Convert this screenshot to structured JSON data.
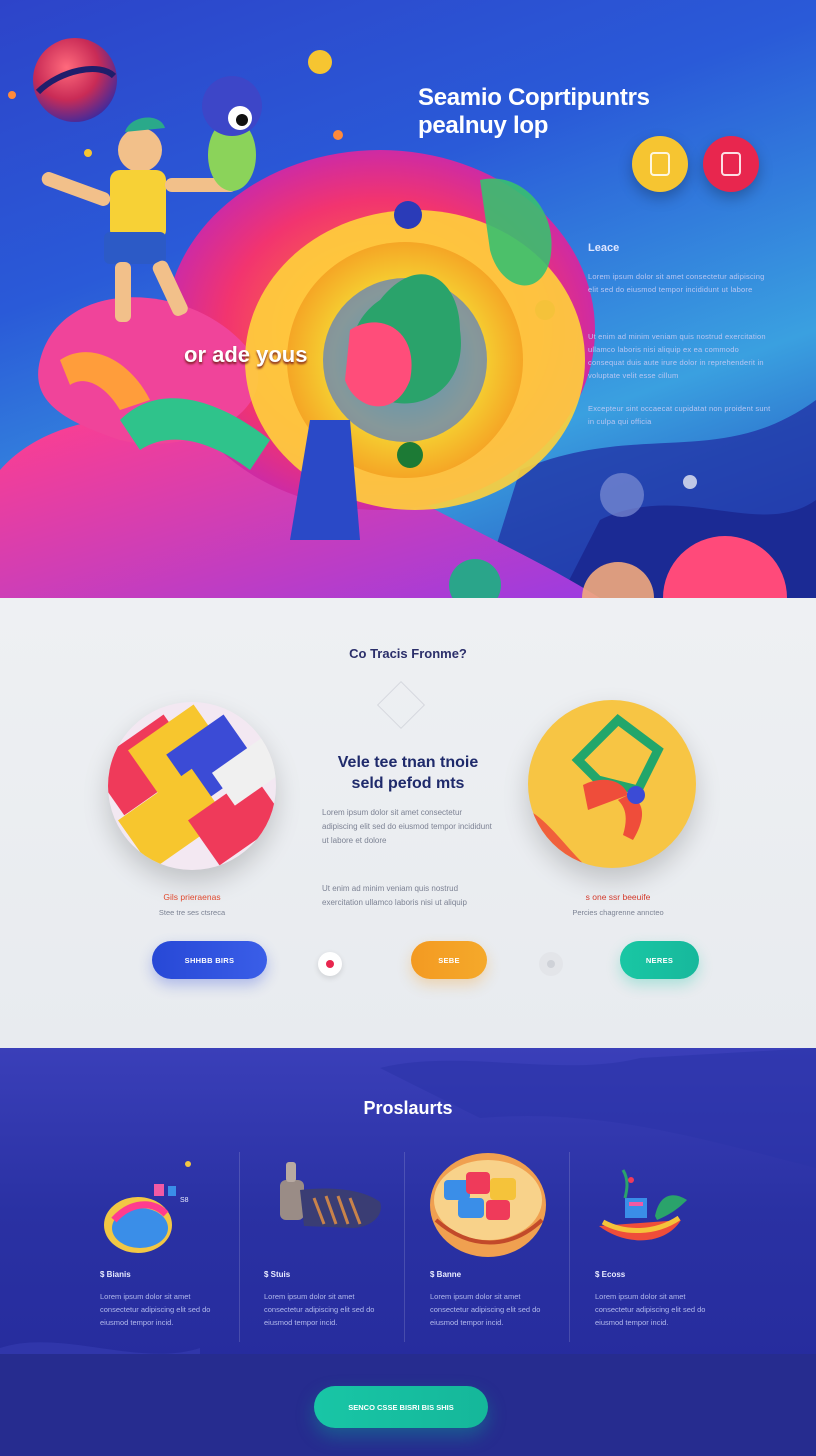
{
  "hero": {
    "title_line1": "Seamio Coprtipuntrs",
    "title_line2": "pealnuy lop",
    "overlay_text": "or ade yous",
    "side_label": "Leace",
    "side_paragraph_1": "Lorem ipsum dolor sit amet consectetur adipiscing elit sed do eiusmod tempor incididunt ut labore",
    "side_paragraph_2": "Ut enim ad minim veniam quis nostrud exercitation ullamco laboris nisi aliquip ex ea commodo consequat duis aute irure dolor in reprehenderit in voluptate velit esse cillum",
    "side_paragraph_3": "Excepteur sint occaecat cupidatat non proident sunt in culpa qui officia",
    "buttons": [
      {
        "color": "#f6c531"
      },
      {
        "color": "#e8264e"
      }
    ]
  },
  "features": {
    "section_title": "Co Tracis Fronme?",
    "center_heading_line1": "Vele tee tnan tnoie",
    "center_heading_line2": "seld pefod mts",
    "center_para_1": "Lorem ipsum dolor sit amet consectetur adipiscing elit sed do eiusmod tempor incididunt ut labore et dolore",
    "center_para_2": "Ut enim ad minim veniam quis nostrud exercitation ullamco laboris nisi ut aliquip",
    "left_caption_title": "Gils prieraenas",
    "left_caption_sub": "Stee tre ses ctsreca",
    "right_caption_title": "s one ssr beeuife",
    "right_caption_sub": "Percies chagrenne anncteo",
    "pill_blue": "SHHBB BIRS",
    "pill_orange": "SEBE",
    "pill_teal": "NERES",
    "colors": {
      "blue": "#2a4ee0",
      "orange": "#f39a22",
      "teal": "#1ec6a2",
      "red": "#e8264e"
    }
  },
  "products": {
    "title": "Proslaurts",
    "items": [
      {
        "name": "$ Bianis",
        "desc": "Lorem ipsum dolor sit amet consectetur adipiscing elit sed do eiusmod tempor incid."
      },
      {
        "name": "$ Stuis",
        "desc": "Lorem ipsum dolor sit amet consectetur adipiscing elit sed do eiusmod tempor incid."
      },
      {
        "name": "$ Banne",
        "desc": "Lorem ipsum dolor sit amet consectetur adipiscing elit sed do eiusmod tempor incid."
      },
      {
        "name": "$ Ecoss",
        "desc": "Lorem ipsum dolor sit amet consectetur adipiscing elit sed do eiusmod tempor incid."
      }
    ],
    "cta_label": "SENCO CSSE BISRI BIS SHIS"
  }
}
